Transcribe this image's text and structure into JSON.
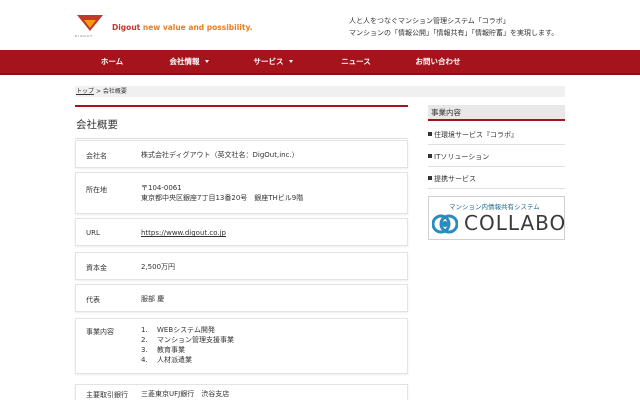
{
  "header": {
    "logo_text": "DIGOUT",
    "brand": "Digout",
    "slogan": " new value and possibility.",
    "intro_line1": "人と人をつなぐマンション管理システム「コラボ」",
    "intro_line2": "マンションの「情報公開」「情報共有」「情報貯蓄」を実現します。"
  },
  "nav": {
    "items": [
      {
        "label": "ホーム"
      },
      {
        "label": "会社情報"
      },
      {
        "label": "サービス"
      },
      {
        "label": "ニュース"
      },
      {
        "label": "お問い合わせ"
      }
    ]
  },
  "breadcrumb": {
    "home": "トップ",
    "separator": ">",
    "current": "会社概要"
  },
  "page": {
    "title": "会社概要"
  },
  "company": {
    "rows": [
      {
        "label": "会社名",
        "value": "株式会社ディグアウト（英文社名：DigOut,inc.）"
      },
      {
        "label": "所在地",
        "value_line1": "〒104-0061",
        "value_line2": "東京都中央区銀座7丁目13番20号　銀座THビル9階"
      },
      {
        "label": "URL",
        "value": "https://www.digout.co.jp"
      },
      {
        "label": "資本金",
        "value": "2,500万円"
      },
      {
        "label": "代表",
        "value": "服部 慶"
      },
      {
        "label": "事業内容",
        "items": [
          {
            "num": "1.",
            "text": "WEBシステム開発"
          },
          {
            "num": "2.",
            "text": "マンション管理支援事業"
          },
          {
            "num": "3.",
            "text": "教育事業"
          },
          {
            "num": "4.",
            "text": "人材派遣業"
          }
        ]
      },
      {
        "label": "主要取引銀行",
        "value": "三菱東京UFJ銀行　渋谷支店"
      }
    ]
  },
  "sidebar": {
    "heading": "事業内容",
    "items": [
      {
        "label": "住環境サービス『コラボ』"
      },
      {
        "label": "ITソリューション"
      },
      {
        "label": "提携サービス"
      }
    ],
    "banner": {
      "caption": "マンション内情報共有システム",
      "word": "COLLABO"
    }
  },
  "colors": {
    "brand_red": "#a5141c",
    "accent_orange": "#e67e22"
  }
}
